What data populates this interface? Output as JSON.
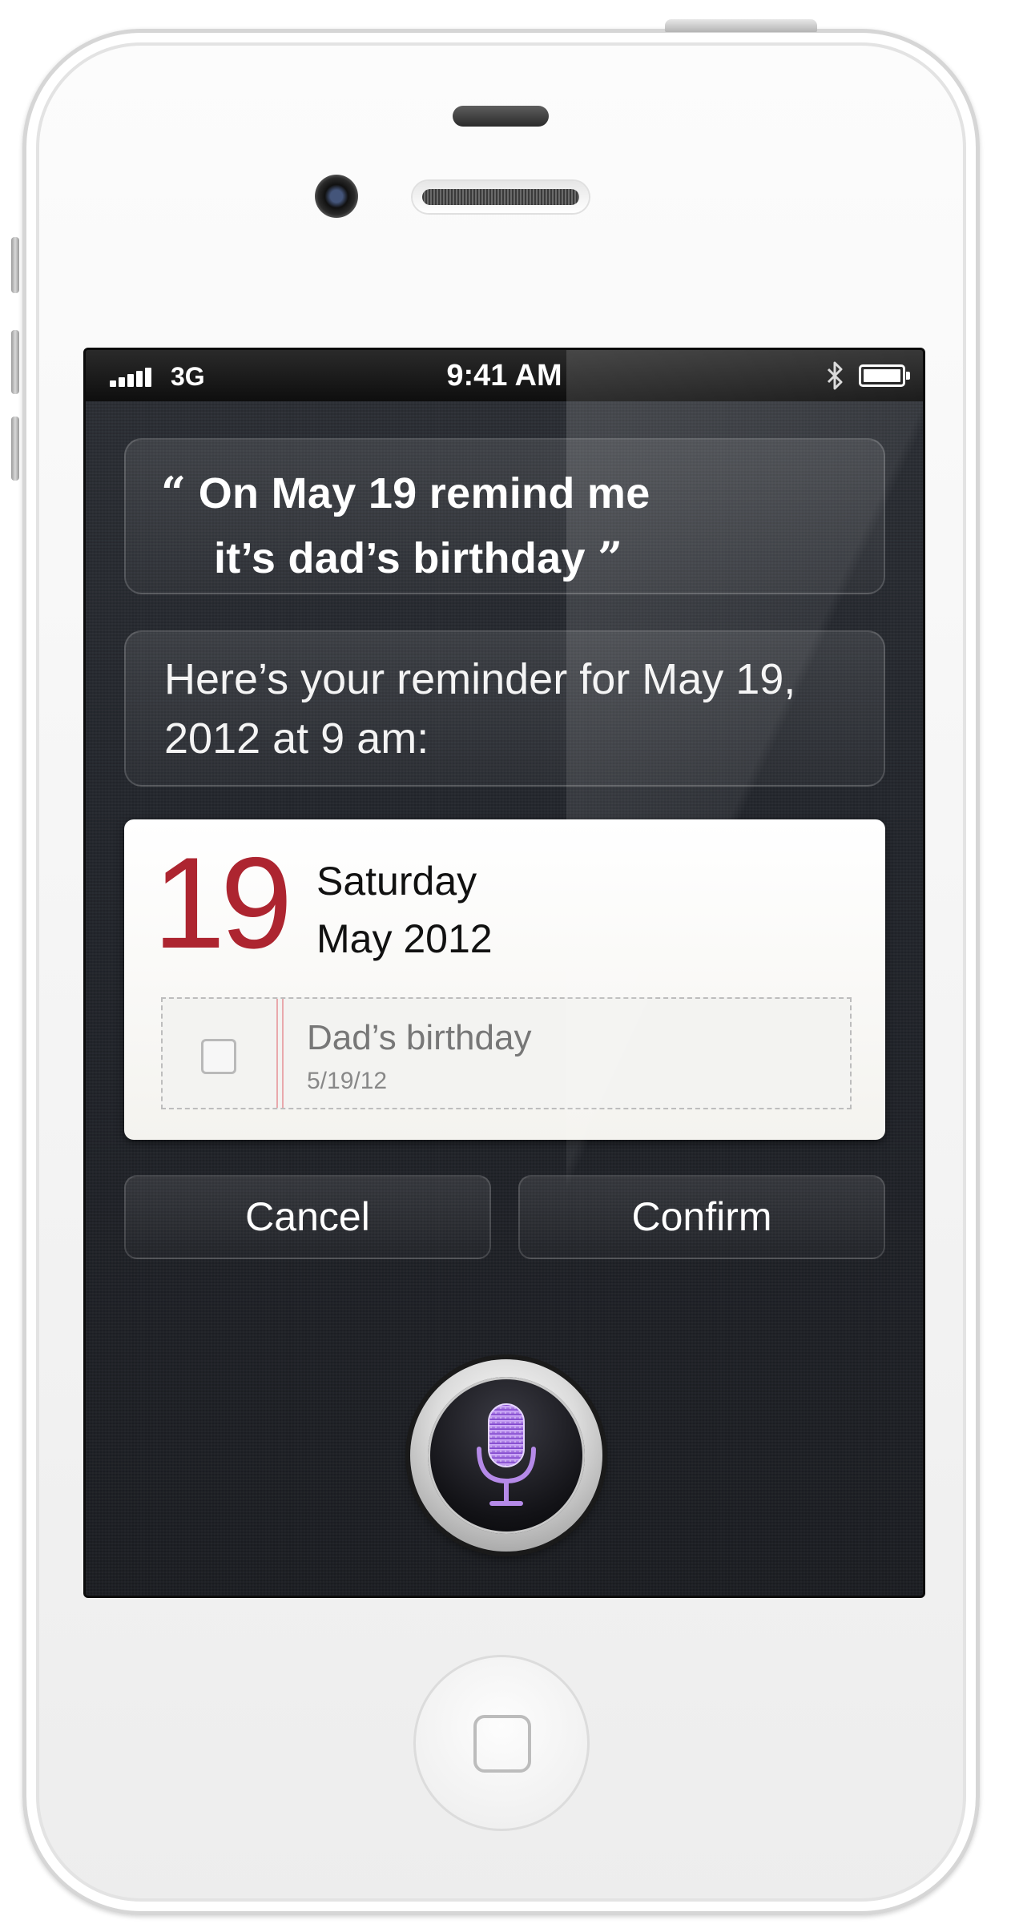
{
  "status_bar": {
    "network": "3G",
    "time": "9:41 AM"
  },
  "conversation": {
    "open_quote": "“",
    "user_line1": "On May 19 remind me",
    "user_line2": "it’s dad’s birthday",
    "close_quote": "”",
    "siri_response": "Here’s your reminder for May 19, 2012 at 9 am:"
  },
  "reminder_card": {
    "day": "19",
    "weekday": "Saturday",
    "month_year": "May 2012",
    "day_color": "#ad2530",
    "item_title": "Dad’s birthday",
    "item_date": "5/19/12",
    "item_checked": false
  },
  "actions": {
    "cancel_label": "Cancel",
    "confirm_label": "Confirm"
  },
  "icons": {
    "signal": "signal-bars-icon",
    "bluetooth": "bluetooth-icon",
    "battery": "battery-icon",
    "microphone": "microphone-icon",
    "home": "home-button"
  }
}
